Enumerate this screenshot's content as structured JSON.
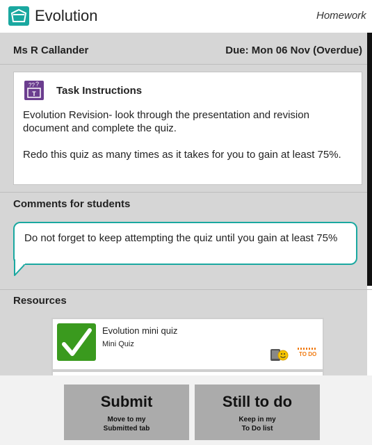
{
  "header": {
    "title": "Evolution",
    "crumb": "Homework"
  },
  "assignment": {
    "teacher": "Ms R Callander",
    "due": "Due: Mon 06 Nov (Overdue)"
  },
  "task": {
    "heading": "Task Instructions",
    "paragraphs": [
      "Evolution Revision- look through the presentation and revision document and complete the quiz.",
      "Redo this quiz as many times as it takes for you to gain at least 75%."
    ]
  },
  "comments": {
    "heading": "Comments for students",
    "text": "Do not forget to keep attempting the quiz until you gain at least 75%"
  },
  "resources": {
    "heading": "Resources",
    "items": [
      {
        "title": "Evolution mini quiz",
        "subtitle": "Mini Quiz",
        "todo_label": "TO DO"
      }
    ]
  },
  "buttons": {
    "submit": {
      "label": "Submit",
      "line1": "Move to my",
      "line2": "Submitted tab"
    },
    "still_todo": {
      "label": "Still to do",
      "line1": "Keep in my",
      "line2": "To Do list"
    }
  },
  "colors": {
    "accent": "#1aa8a0",
    "task_icon": "#6b3d8f",
    "quiz_green": "#3a9a1e",
    "todo_orange": "#f07a10"
  },
  "icons": {
    "logo": "folder-book-icon",
    "task": "question-board-icon",
    "quiz": "checkmark-icon",
    "tablet": "tablet-smiley-icon"
  }
}
